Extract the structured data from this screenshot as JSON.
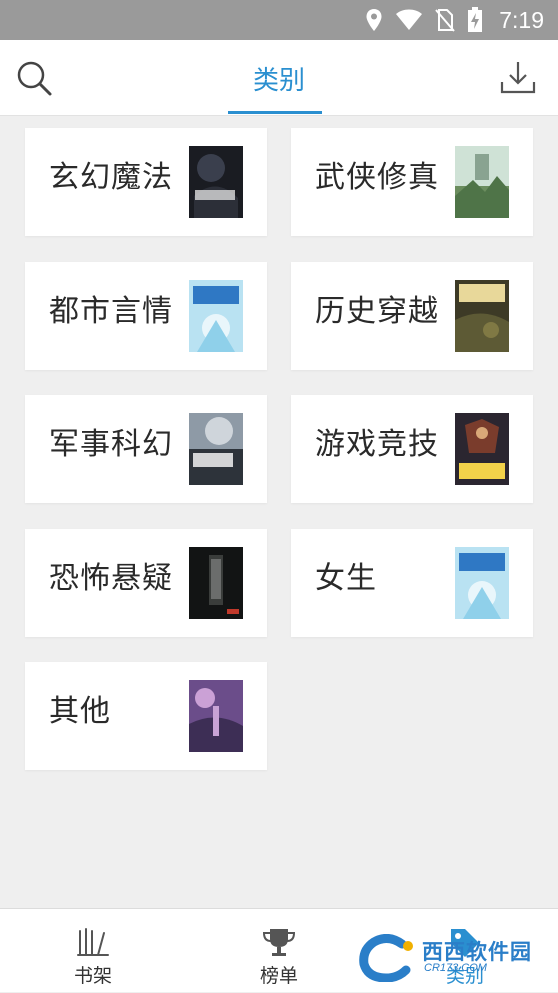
{
  "status_bar": {
    "time": "7:19"
  },
  "header": {
    "title": "类别"
  },
  "categories": [
    {
      "label": "玄幻魔法",
      "cover": "dark"
    },
    {
      "label": "武侠修真",
      "cover": "green"
    },
    {
      "label": "都市言情",
      "cover": "blue"
    },
    {
      "label": "历史穿越",
      "cover": "olive"
    },
    {
      "label": "军事科幻",
      "cover": "grey"
    },
    {
      "label": "游戏竞技",
      "cover": "warrior"
    },
    {
      "label": "恐怖悬疑",
      "cover": "black"
    },
    {
      "label": "女生",
      "cover": "blue"
    },
    {
      "label": "其他",
      "cover": "purple"
    }
  ],
  "bottom_nav": [
    {
      "label": "书架"
    },
    {
      "label": "榜单"
    },
    {
      "label": "类别"
    }
  ],
  "watermark": {
    "text": "西西软件园",
    "sub": "CR173.COM"
  },
  "colors": {
    "accent": "#2a8fd0",
    "status_bar": "#9a9a9a",
    "background": "#efefef"
  }
}
